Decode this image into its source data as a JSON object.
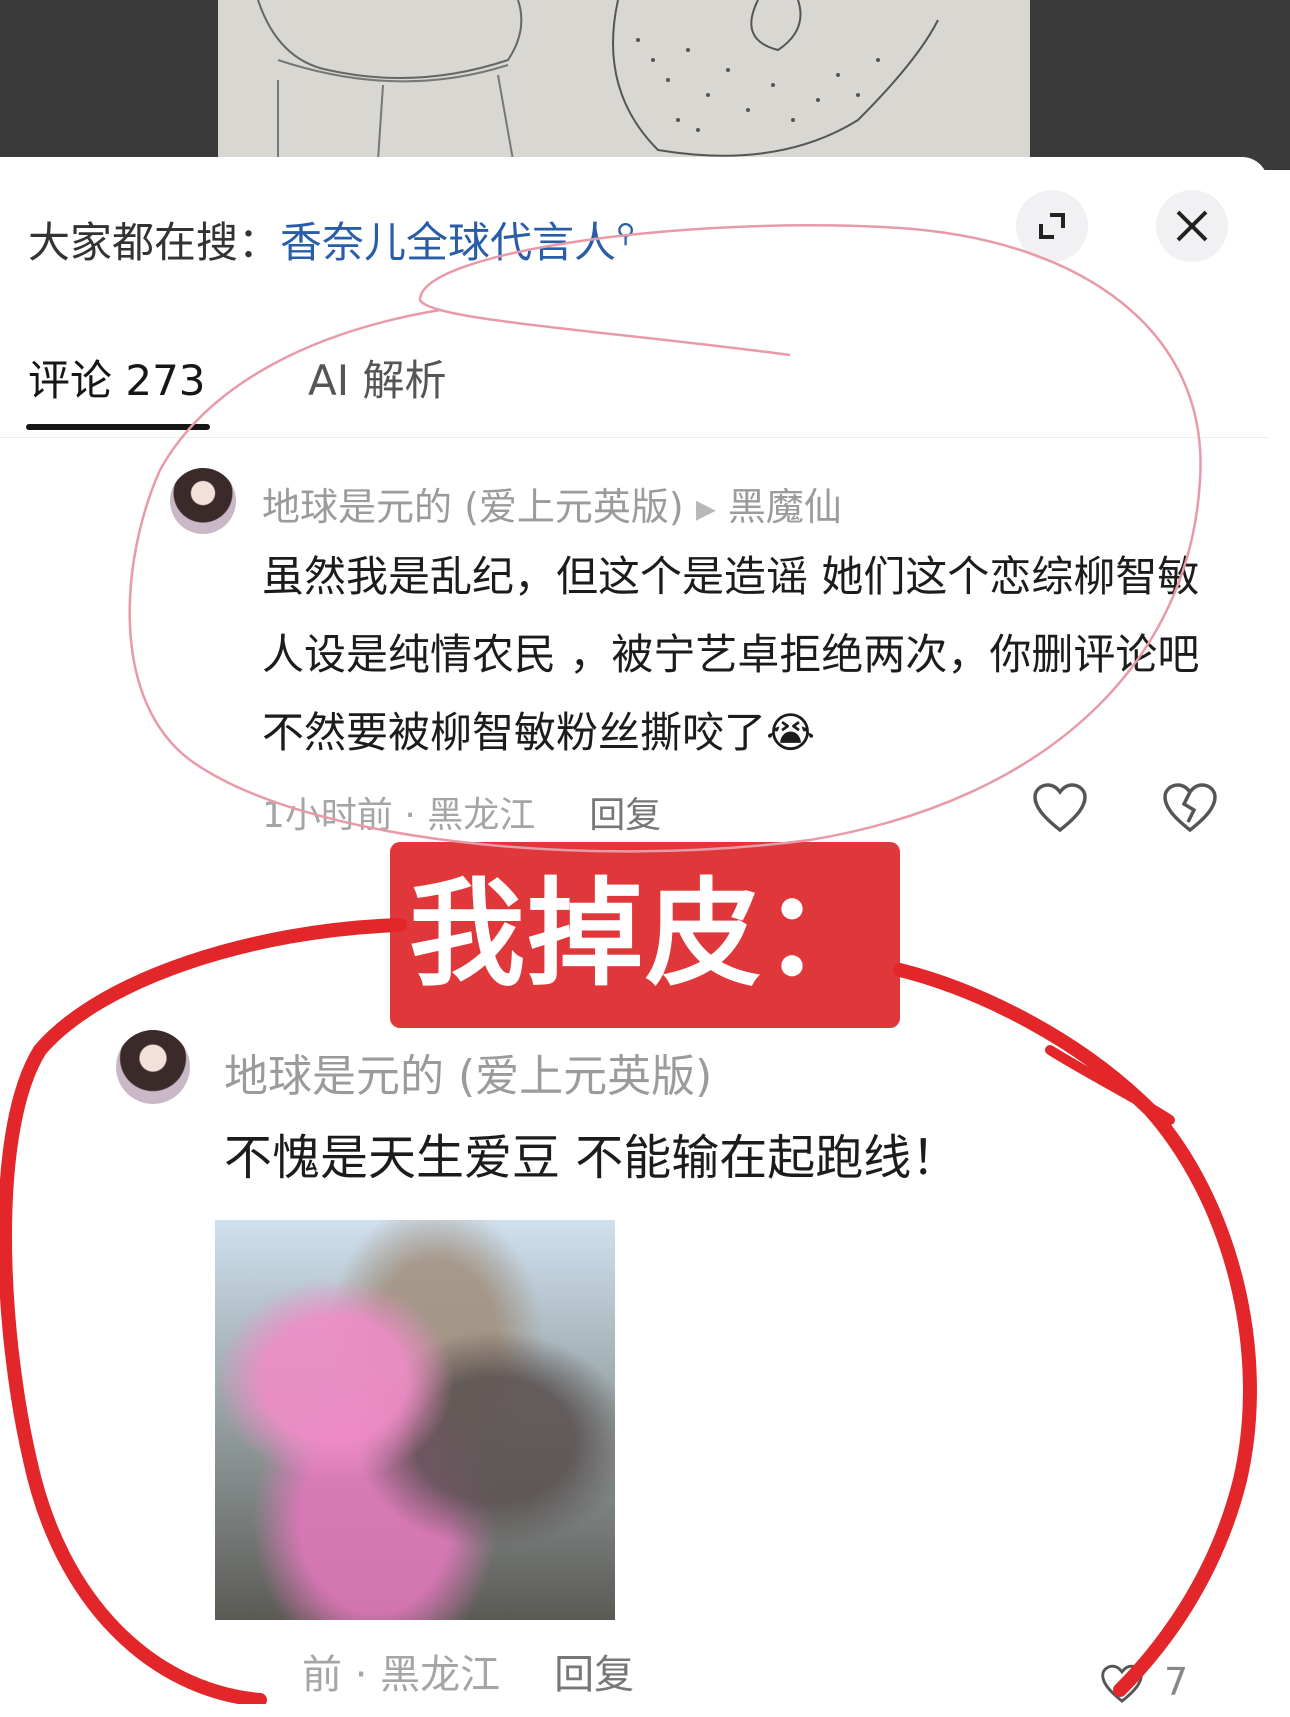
{
  "sheet": {
    "trending_prefix": "大家都在搜：",
    "trending_keyword": "香奈儿全球代言人",
    "expand_icon": "expand-icon",
    "close_icon": "close-icon"
  },
  "tabs": [
    {
      "label": "评论 273",
      "active": true
    },
    {
      "label": "AI 解析",
      "active": false
    }
  ],
  "comments": [
    {
      "username": "地球是元的 (爱上元英版)",
      "reply_to": "黑魔仙",
      "text": "虽然我是乱纪，但这个是造谣 她们这个恋综柳智敏人设是纯情农民 ，被宁艺卓拒绝两次，你删评论吧不然要被柳智敏粉丝撕咬了😭",
      "meta": "1小时前 · 黑龙江",
      "reply_label": "回复"
    },
    {
      "username": "地球是元的 (爱上元英版)",
      "text": "不愧是天生爱豆 不能输在起跑线！",
      "meta": "前 · 黑龙江",
      "reply_label": "回复",
      "like_count": "7"
    }
  ],
  "overlay": {
    "text": "我掉皮：",
    "color": "#e0383a"
  },
  "colors": {
    "link_blue": "#2a5da8",
    "annotation_red": "#e3262a",
    "annotation_pink": "#e89aa8"
  }
}
